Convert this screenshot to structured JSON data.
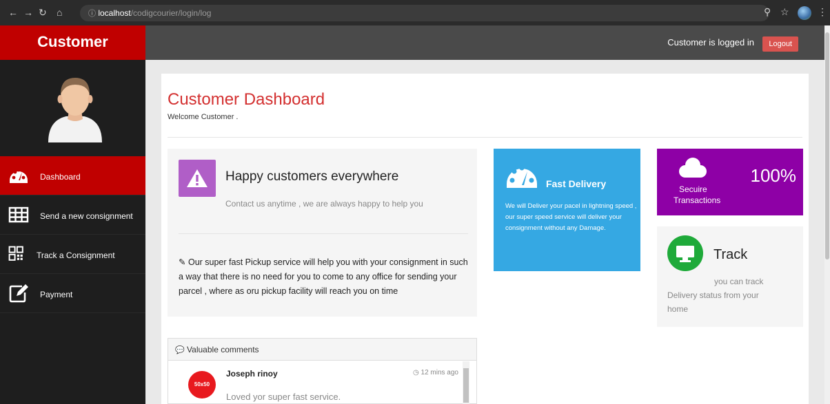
{
  "browser": {
    "url_host": "localhost",
    "url_path": "/codigcourier/login/log"
  },
  "sidebar": {
    "brand": "Customer",
    "items": [
      {
        "label": "Dashboard",
        "icon": "dashboard-icon"
      },
      {
        "label": "Send a new consignment",
        "icon": "grid-icon"
      },
      {
        "label": "Track a Consignment",
        "icon": "qrcode-icon"
      },
      {
        "label": "Payment",
        "icon": "edit-icon"
      }
    ]
  },
  "topbar": {
    "status": "Customer is logged in",
    "logout_label": "Logout"
  },
  "main": {
    "title": "Customer Dashboard",
    "welcome": "Welcome Customer ."
  },
  "happy": {
    "title": "Happy customers everywhere",
    "subtitle": "Contact us anytime , we are always happy to help you",
    "description": "Our super fast Pickup service will help you with your consignment in such a way that there is no need for you to come to any office for sending your parcel , where as oru pickup facility will reach you on time"
  },
  "fast_delivery": {
    "title": "Fast Delivery",
    "text": "We will Deliver your pacel in lightning speed , our super speed service will deliver your consignment without any Damage."
  },
  "secure": {
    "label_line1": "Secuire",
    "label_line2": "Transactions",
    "percent": "100%"
  },
  "track": {
    "title": "Track",
    "text_line1": "you can track",
    "text_line2": "Delivery status from your",
    "text_line3": "home"
  },
  "comments": {
    "header": "Valuable comments",
    "items": [
      {
        "avatar_text": "50x50",
        "name": "Joseph rinoy",
        "time": "12 mins ago",
        "text": "Loved yor super fast service."
      }
    ]
  },
  "colors": {
    "brand_red": "#c00000",
    "title_red": "#d32f2f",
    "fast_blue": "#35a8e3",
    "secure_purple": "#8e00a6",
    "track_green": "#1faa3a",
    "warn_purple": "#b05ec7",
    "logout_red": "#d9534f"
  }
}
